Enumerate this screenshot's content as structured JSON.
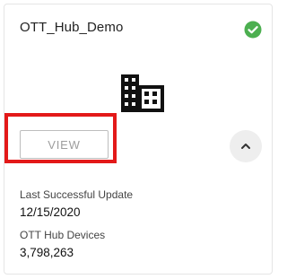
{
  "card": {
    "title": "OTT_Hub_Demo",
    "status_icon": "check-circle-icon",
    "status_color": "#4caf50",
    "main_icon": "building-icon",
    "view_button_label": "VIEW",
    "collapse_icon": "chevron-up-icon",
    "highlight_color": "#e31919"
  },
  "details": [
    {
      "label": "Last Successful Update",
      "value": "12/15/2020"
    },
    {
      "label": "OTT Hub Devices",
      "value": "3,798,263"
    }
  ]
}
